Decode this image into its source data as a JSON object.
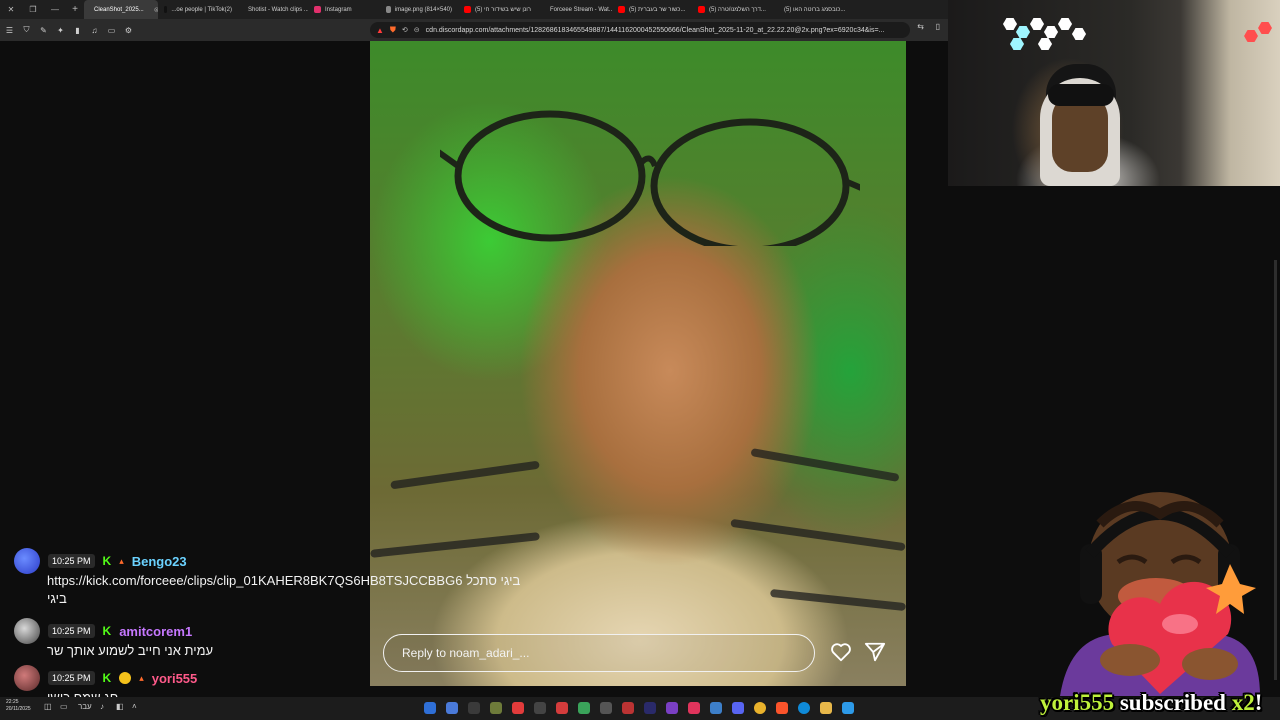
{
  "browser": {
    "tabs": [
      {
        "label": "CleanShot_2025...",
        "active": true,
        "color": "#ffffff"
      },
      {
        "label": "...oe people | TikTok(2)",
        "color": "#111111"
      },
      {
        "label": "Shotist - Watch clips ...",
        "color": "#53fc18"
      },
      {
        "label": "Instagram",
        "color": "#e1306c"
      },
      {
        "label": "image.png (814×540)",
        "color": "#888888"
      },
      {
        "label": "(5) רונן שיש בשידור חי",
        "color": "#ff0000"
      },
      {
        "label": "Forceee Stream - Wat...",
        "color": "#53fc18"
      },
      {
        "label": "(5) כשור שר בעברית...",
        "color": "#ff0000"
      },
      {
        "label": "(5) דרך השלמנו/טרה...",
        "color": "#ff0000"
      },
      {
        "label": "(5) כובסמג ברוטה האו...",
        "color": "#ff0000"
      }
    ],
    "url": "cdn.discordapp.com/attachments/1282686183465549887/1441162000452550666/CleanShot_2025-11-20_at_22.22.20@2x.png?ex=6920c34&is=..."
  },
  "story": {
    "reply_placeholder": "Reply to noam_adari_..."
  },
  "chat": {
    "messages": [
      {
        "time": "10:25 PM",
        "user": "Bengo23",
        "user_color": "#6bd2ff",
        "badge": "K",
        "lines": [
          "https://kick.com/forceee/clips/clip_01KAHER8BK7QS6HB8TSJCCBBG6 ביגי סתכל",
          "ביגי"
        ]
      },
      {
        "time": "10:25 PM",
        "user": "amitcorem1",
        "user_color": "#c678ff",
        "badge": "K",
        "lines": [
          "עמית אני חייב לשמוע אותך שר"
        ]
      },
      {
        "time": "10:25 PM",
        "user": "yori555",
        "user_color": "#ff5a8a",
        "badge": "K",
        "lines": [
          "חג שמח כושי"
        ]
      }
    ]
  },
  "alert": {
    "username": "yori555",
    "action": "subscribed",
    "multiplier": "x2",
    "exclaim": "!"
  },
  "taskbar": {
    "time": "22:25",
    "date": "20/11/2025",
    "lang": "עבר"
  }
}
